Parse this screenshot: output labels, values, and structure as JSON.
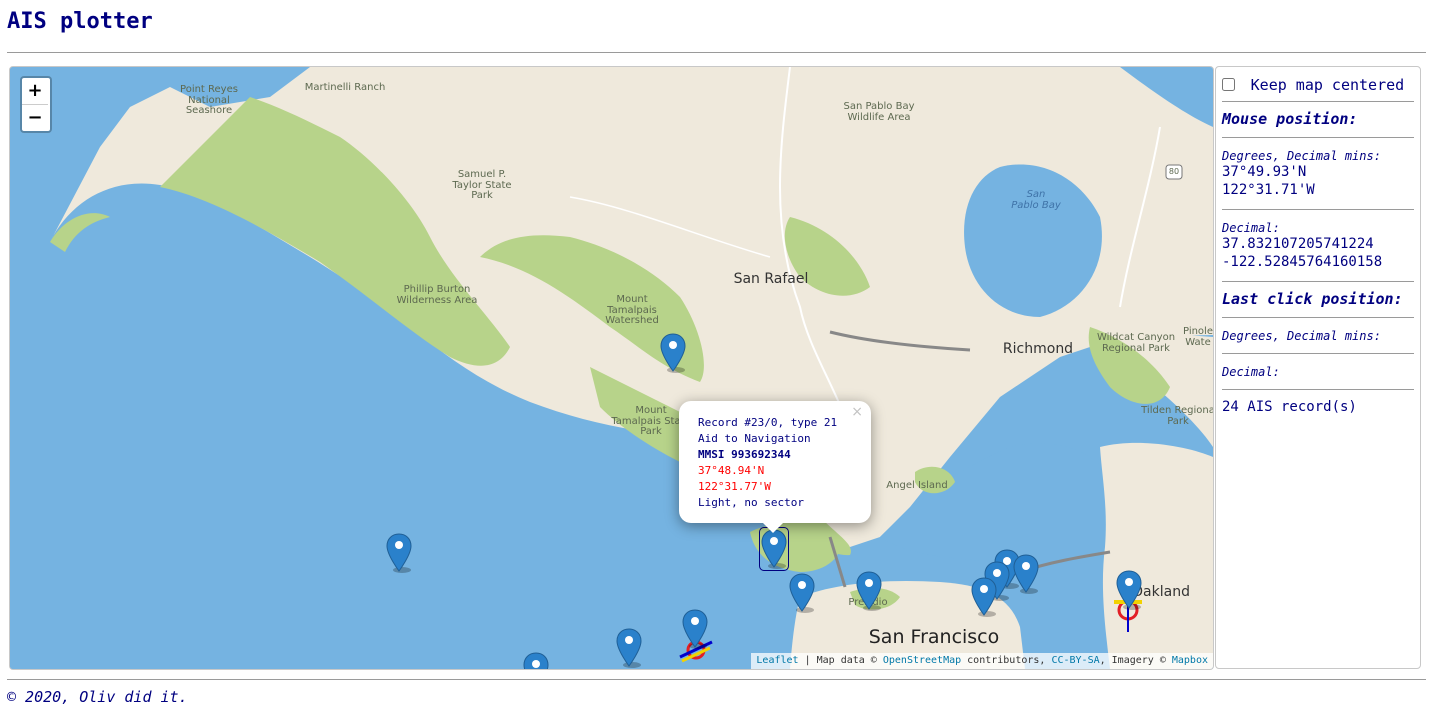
{
  "page": {
    "title": "AIS plotter",
    "footer": "© 2020, Oliv did it."
  },
  "map": {
    "zoom_in_label": "+",
    "zoom_out_label": "−",
    "place_labels": [
      {
        "text": "Point Reyes\nNational\nSeashore",
        "kind": "small"
      },
      {
        "text": "Martinelli Ranch",
        "kind": "small"
      },
      {
        "text": "Samuel P.\nTaylor State\nPark",
        "kind": "small"
      },
      {
        "text": "Phillip Burton\nWilderness Area",
        "kind": "small"
      },
      {
        "text": "Mount\nTamalpais\nWatershed",
        "kind": "small"
      },
      {
        "text": "Mount\nTamalpais State\nPark",
        "kind": "small"
      },
      {
        "text": "San Pablo Bay\nWildlife Area",
        "kind": "small"
      },
      {
        "text": "San\nPablo Bay",
        "kind": "water"
      },
      {
        "text": "San Rafael",
        "kind": "city"
      },
      {
        "text": "Richmond",
        "kind": "city"
      },
      {
        "text": "Wildcat Canyon\nRegional Park",
        "kind": "small"
      },
      {
        "text": "Pinole\nWate",
        "kind": "small"
      },
      {
        "text": "Tilden Regiona\nPark",
        "kind": "small"
      },
      {
        "text": "Angel Island",
        "kind": "small"
      },
      {
        "text": "Presidio",
        "kind": "small"
      },
      {
        "text": "San Francisco",
        "kind": "bigcity"
      },
      {
        "text": "Oakland",
        "kind": "city"
      },
      {
        "text": "80",
        "kind": "small"
      }
    ],
    "marker_count_shown": 13,
    "popup": {
      "close_label": "×",
      "record": "Record #23/0, type 21",
      "category": "Aid to Navigation",
      "mmsi": "MMSI 993692344",
      "lat": "37°48.94'N",
      "lon": "122°31.77'W",
      "description": "Light, no sector"
    },
    "attribution": {
      "leaflet": "Leaflet",
      "text1": " | Map data © ",
      "osm": "OpenStreetMap",
      "text2": " contributors, ",
      "license": "CC-BY-SA",
      "text3": ", Imagery © ",
      "mapbox": "Mapbox"
    }
  },
  "sidebar": {
    "keep_centered_label": "Keep map centered",
    "keep_centered_checked": false,
    "mouse_heading": "Mouse position:",
    "degrees_label": "Degrees, Decimal mins:",
    "mouse_lat": "37°49.93'N",
    "mouse_lon": "122°31.71'W",
    "decimal_label": "Decimal:",
    "mouse_lat_dec": "37.832107205741224",
    "mouse_lon_dec": "-122.52845764160158",
    "last_click_heading": "Last click position:",
    "click_degrees_label": "Degrees, Decimal mins:",
    "click_decimal_label": "Decimal:",
    "record_count": "24 AIS record(s)"
  },
  "colors": {
    "water": "#75b3e1",
    "land": "#efe9dc",
    "park": "#b7d38a",
    "marker": "#2a81cb",
    "text": "#000080"
  }
}
